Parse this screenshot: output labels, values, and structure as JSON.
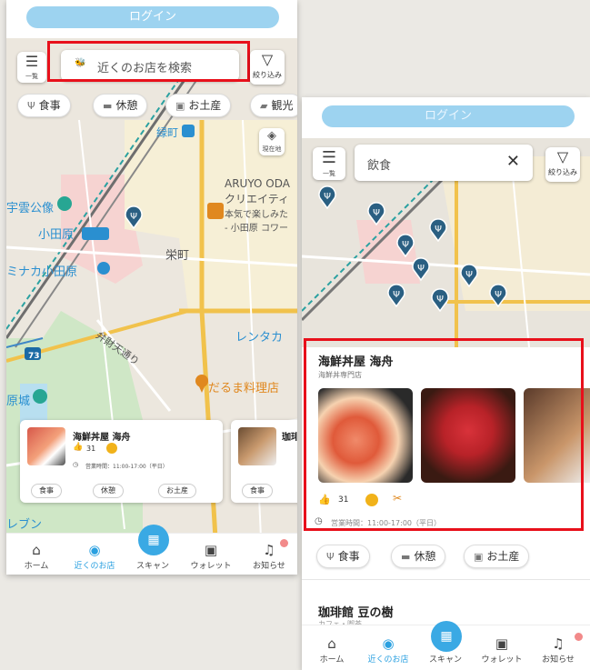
{
  "phone1": {
    "login_label": "ログイン",
    "menu_label": "一覧",
    "search_placeholder": "近くのお店を検索",
    "filter_label": "絞り込み",
    "chips": [
      "食事",
      "休憩",
      "お土産",
      "観光"
    ],
    "current_location_label": "現在地",
    "map_labels": {
      "aruyo": "ARUYO ODA",
      "creative": "クリエイティ",
      "honki": "本気で楽しみた",
      "odawara_tower": "- 小田原 コワー",
      "sakaemachi": "栄町",
      "odawara": "小田原",
      "mina": "ミナカ小田原",
      "yukumo": "宇雲公像",
      "rental": "レンタカ",
      "bentenmachi": "弁財天通り",
      "daruma": "だるま料理店",
      "nishiki": "緑町",
      "jyo": "原城",
      "route_73": "73",
      "lebun": "レブン"
    },
    "card1": {
      "name": "海鮮丼屋 海舟",
      "likes": "31",
      "hours": "営業時間：11:00-17:00（平日）",
      "chips": [
        "食事",
        "休憩",
        "お土産"
      ]
    },
    "card2": {
      "name": "珈琲",
      "chips": [
        "食事"
      ]
    }
  },
  "phone2": {
    "login_label": "ログイン",
    "menu_label": "一覧",
    "search_value": "飲食",
    "filter_label": "絞り込み",
    "shop_name": "海鮮丼屋 海舟",
    "shop_category": "海鮮丼専門店",
    "likes": "31",
    "hours": "営業時間：11:00-17:00（平日）",
    "chips": [
      "食事",
      "休憩",
      "お土産"
    ],
    "next_shop_name": "珈琲館 豆の樹",
    "next_shop_category": "カフェ・喫茶"
  },
  "nav": {
    "home": "ホーム",
    "nearby": "近くのお店",
    "scan": "スキャン",
    "wallet": "ウォレット",
    "notice": "お知らせ"
  },
  "colors": {
    "accent": "#2aa0e0",
    "highlight_box": "#e8101b",
    "pin": "#2a5f82"
  }
}
